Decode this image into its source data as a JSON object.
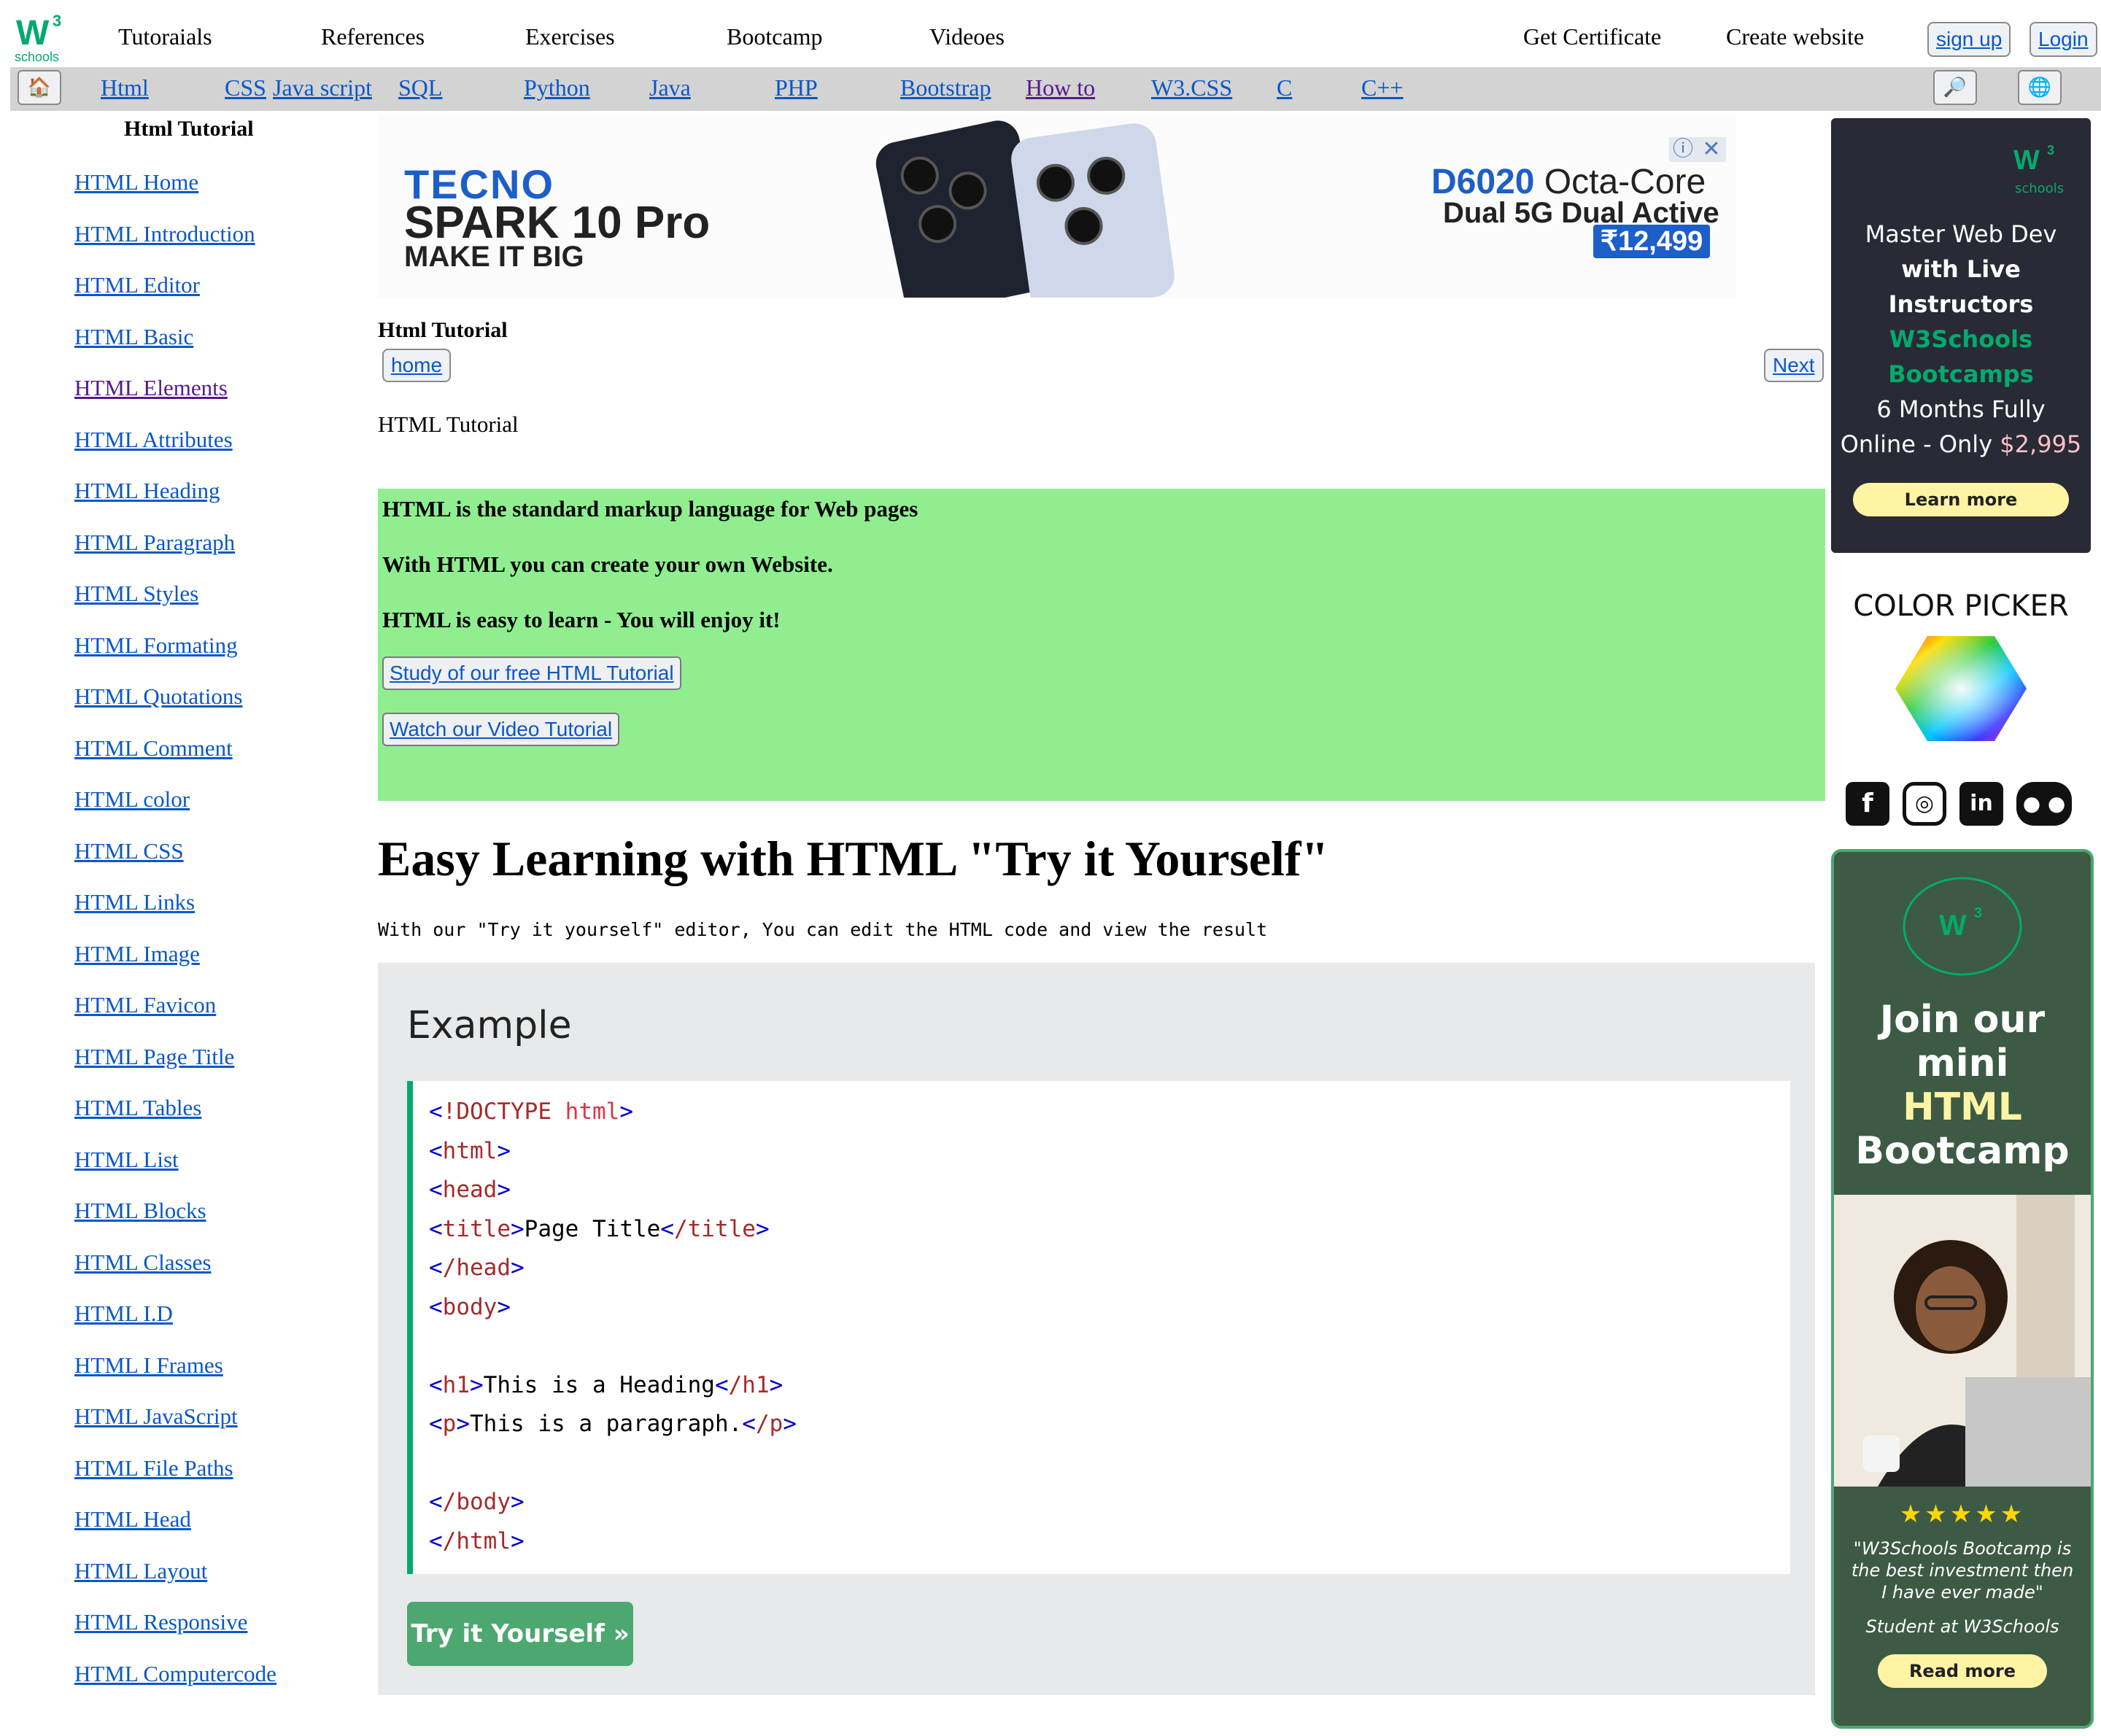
{
  "topnav": {
    "logo_w": "W",
    "logo_three": "3",
    "logo_schools": "schools",
    "items": [
      "Tutoraials",
      "References",
      "Exercises",
      "Bootcamp",
      "Videoes"
    ],
    "get_certificate": "Get Certificate",
    "create_website": "Create website",
    "signup": "sign up",
    "login": "Login"
  },
  "subnav": {
    "home_icon": "house-icon",
    "links": [
      "Html",
      "CSS",
      "Java script",
      "SQL",
      "Python",
      "Java",
      "PHP",
      "Bootstrap",
      "How to",
      "W3.CSS",
      "C",
      "C++"
    ],
    "search_icon": "magnifier-icon",
    "globe_icon": "globe-icon"
  },
  "sidebar": {
    "title": "Html Tutorial",
    "links": [
      "HTML Home",
      "HTML Introduction",
      "HTML Editor",
      "HTML Basic",
      "HTML Elements",
      "HTML Attributes",
      "HTML Heading",
      "HTML Paragraph",
      "HTML Styles",
      "HTML Formating",
      "HTML Quotations",
      "HTML Comment",
      "HTML color",
      "HTML CSS",
      "HTML Links",
      "HTML Image",
      "HTML Favicon",
      "HTML Page Title",
      "HTML Tables",
      "HTML List",
      "HTML Blocks",
      "HTML Classes",
      "HTML I.D",
      "HTML I Frames",
      "HTML JavaScript",
      "HTML File Paths",
      "HTML Head",
      "HTML Layout",
      "HTML Responsive",
      "HTML Computercode"
    ]
  },
  "ad": {
    "brand_line1": "TECNO",
    "brand_line2": "SPARK 10 Pro",
    "brand_line3": "MAKE IT BIG",
    "model": "D6020",
    "model_suffix": " Octa-Core",
    "features": "Dual 5G Dual Active",
    "price": "₹12,499",
    "info_icon": "ⓘ",
    "close_icon": "✕"
  },
  "main": {
    "title": "Html Tutorial",
    "home_button": "home",
    "next_button": "Next",
    "crumb": "HTML Tutorial",
    "green": {
      "line1": "HTML is the standard markup language for Web pages",
      "line2": "With HTML you can create your own Website.",
      "line3": "HTML is easy to learn - You will enjoy it!",
      "button1": "Study of our free HTML Tutorial",
      "button2": "Watch our Video Tutorial"
    },
    "heading": "Easy Learning with HTML \"Try it Yourself\"",
    "lead": "With our \"Try it yourself\" editor, You can edit the HTML code and view the result",
    "example": {
      "title": "Example",
      "lines": [
        "<!DOCTYPE html>",
        "<html>",
        "<head>",
        "<title>Page Title</title>",
        "</head>",
        "<body>",
        "",
        "<h1>This is a Heading</h1>",
        "<p>This is a paragraph.</p>",
        "",
        "</body>",
        "</html>"
      ],
      "try_button": "Try it Yourself »"
    }
  },
  "right": {
    "ad1": {
      "line1": "Master Web Dev",
      "line2": "with Live",
      "line3": "Instructors",
      "line4": "W3Schools",
      "line5": "Bootcamps",
      "line6": "6 Months Fully",
      "line7a": "Online - Only ",
      "line7b": "$2,995",
      "button": "Learn more"
    },
    "color_picker_title": "COLOR PICKER",
    "social_icons": [
      "facebook-icon",
      "instagram-icon",
      "linkedin-icon",
      "discord-icon"
    ],
    "ad2": {
      "line1": "Join our",
      "line2": "mini",
      "line3": "HTML",
      "line4": "Bootcamp",
      "stars": "★★★★★",
      "quote": "\"W3Schools Bootcamp is the best investment then I have ever made\"",
      "student": "Student at W3Schools",
      "button": "Read more"
    }
  },
  "colors": {
    "green_panel": "#90ee90",
    "accent_green": "#04aa6d",
    "link_blue": "#0b57c7",
    "visited_purple": "#551a8b",
    "example_bg": "#e7e9eb"
  }
}
